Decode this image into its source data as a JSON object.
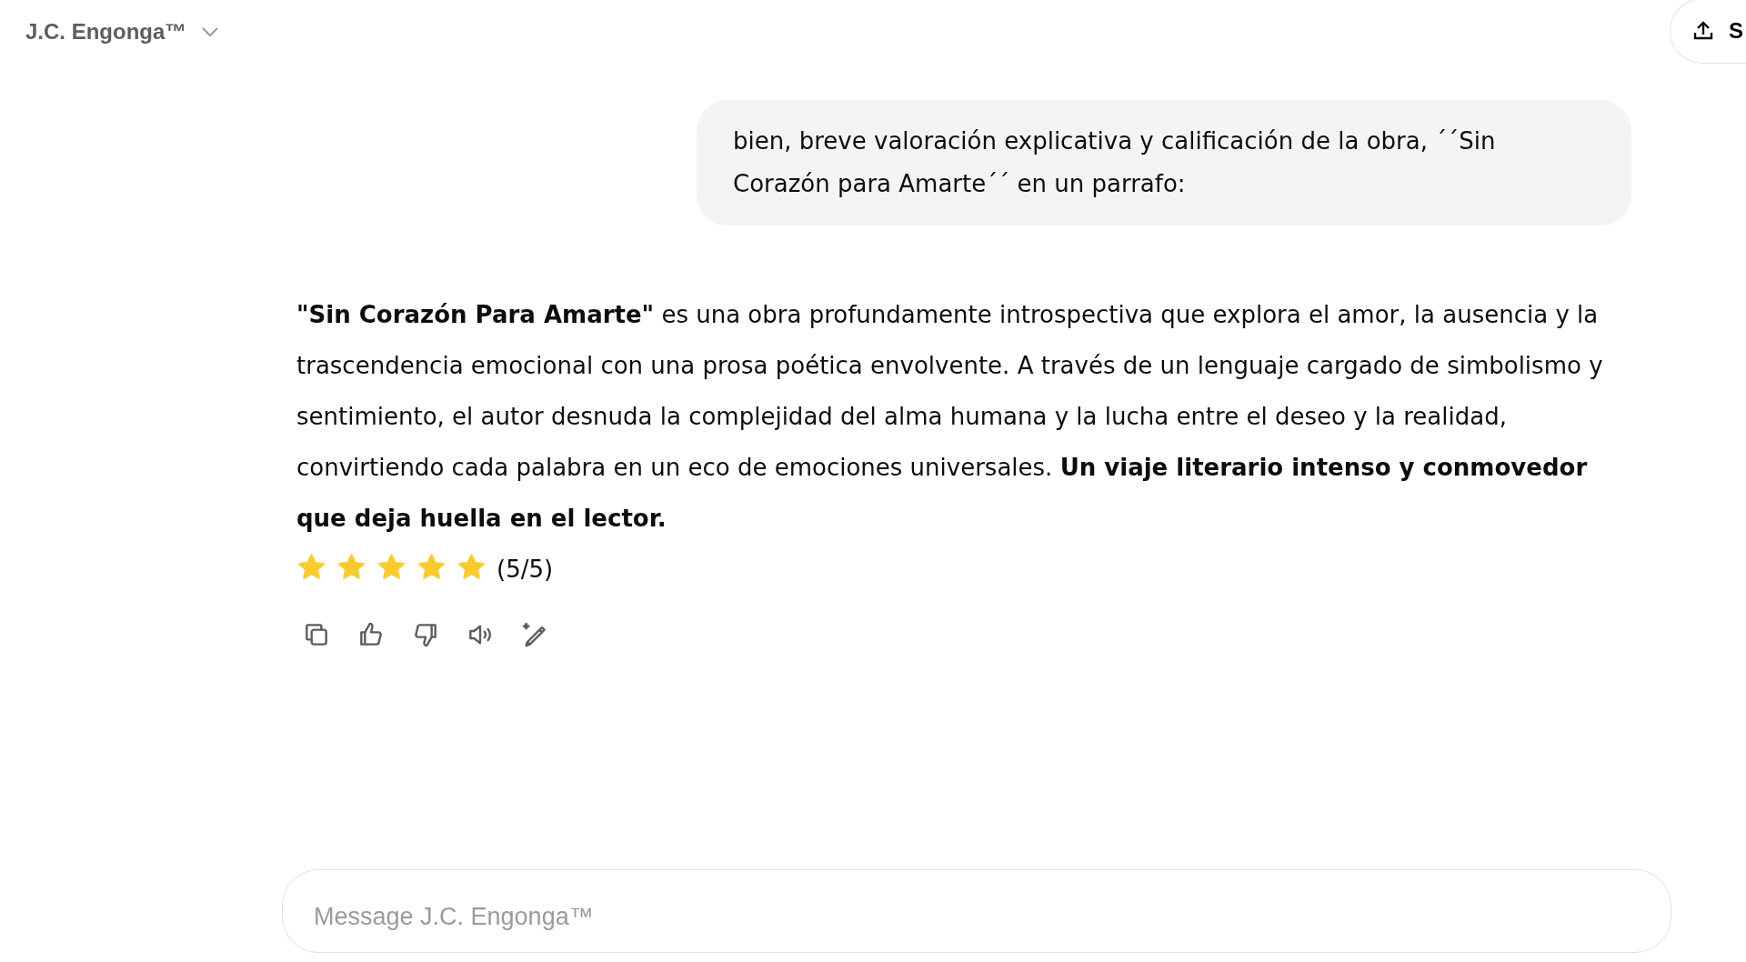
{
  "header": {
    "title": "J.C. Engonga™",
    "share_label": "S"
  },
  "user_message": {
    "text": "bien, breve valoración explicativa y calificación de la obra, ´´Sin Corazón para Amarte´´ en un parrafo:"
  },
  "assistant_message": {
    "text": "**\"Sin Corazón Para Amarte\"** es una obra profundamente introspectiva que explora el amor, la ausencia y la trascendencia emocional con una prosa poética envolvente. A través de un lenguaje cargado de simbolismo y sentimiento, el autor desnuda la complejidad del alma humana y la lucha entre el deseo y la realidad, convirtiendo cada palabra en un eco de emociones universales. **Un viaje literario intenso y conmovedor que deja huella en el lector.**",
    "stars": 5,
    "rating": "(5/5)"
  },
  "actions": [
    {
      "kind": "copy"
    },
    {
      "kind": "like"
    },
    {
      "kind": "dislike"
    },
    {
      "kind": "read"
    },
    {
      "kind": "edit"
    }
  ],
  "composer": {
    "placeholder": "Message J.C. Engonga™"
  }
}
